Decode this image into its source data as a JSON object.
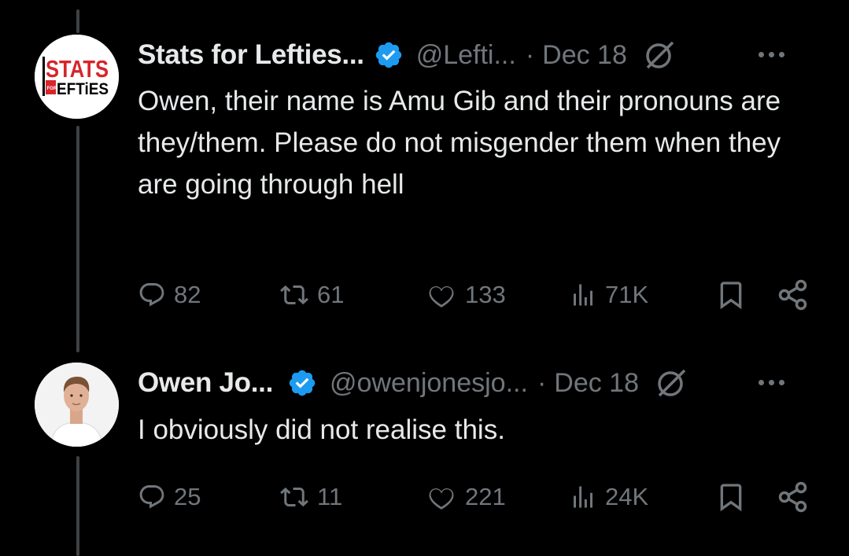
{
  "tweets": [
    {
      "author_name": "Stats for Lefties...",
      "handle": "@Lefti...",
      "separator": "·",
      "date": "Dec 18",
      "avatar_text_top": "STATS",
      "avatar_text_small": "FOR",
      "avatar_text_bottom": "EFTiES",
      "text": "Owen, their name is Amu Gib and their pronouns are they/them. Please do not misgender them when they are going through hell",
      "replies": "82",
      "reposts": "61",
      "likes": "133",
      "views": "71K"
    },
    {
      "author_name": "Owen Jo...",
      "handle": "@owenjonesjo...",
      "separator": "·",
      "date": "Dec 18",
      "text": "I obviously did not realise this.",
      "replies": "25",
      "reposts": "11",
      "likes": "221",
      "views": "24K"
    }
  ],
  "colors": {
    "background": "#000000",
    "primary_text": "#e7e9ea",
    "secondary_text": "#71767b",
    "verified_blue": "#1d9bf0",
    "thread_line": "#3e4144",
    "stats_logo_red": "#d6252b"
  },
  "icons": [
    "verified-badge-icon",
    "grok-icon",
    "more-icon",
    "reply-icon",
    "repost-icon",
    "like-icon",
    "views-icon",
    "bookmark-icon",
    "share-icon"
  ]
}
